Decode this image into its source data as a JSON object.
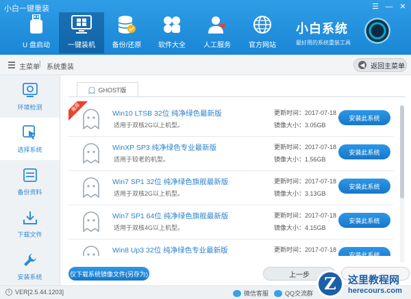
{
  "window": {
    "title": "小白一键重装"
  },
  "toolbar": [
    {
      "label": "U 盘启动",
      "icon": "usb-drive-icon"
    },
    {
      "label": "一键装机",
      "icon": "monitor-windows-icon",
      "active": true
    },
    {
      "label": "备份/还原",
      "icon": "database-backup-icon"
    },
    {
      "label": "软件大全",
      "icon": "apps-clover-icon"
    },
    {
      "label": "人工服务",
      "icon": "person-heart-icon"
    },
    {
      "label": "官方网站",
      "icon": "globe-icon"
    }
  ],
  "brand": {
    "name": "小白系统",
    "slogan": "最好用的系统重装工具"
  },
  "breadcrumb": {
    "home": "主菜单",
    "separator": "|",
    "current": "系统重装"
  },
  "back_button": "返回主菜单",
  "sidebar": [
    {
      "label": "环境检测",
      "icon": "checkup-icon"
    },
    {
      "label": "选择系统",
      "icon": "cursor-select-icon",
      "active": true
    },
    {
      "label": "备份资料",
      "icon": "backup-list-icon"
    },
    {
      "label": "下载文件",
      "icon": "download-icon"
    },
    {
      "label": "安装系统",
      "icon": "wrench-icon"
    }
  ],
  "tab": {
    "label": "GHOST版"
  },
  "systems": [
    {
      "title": "Win10 LTSB 32位 纯净绿色最新版",
      "desc": "适用于双核2G以上机型。",
      "updated": "更新时间：2017-07-18",
      "size": "镜像大小：3.05GB",
      "button": "安装此系统",
      "badge": "推荐"
    },
    {
      "title": "WinXP SP3 纯净绿色专业最新版",
      "desc": "适用于较老的机型。",
      "updated": "更新时间：2017-07-18",
      "size": "镜像大小：1.56GB",
      "button": "安装此系统"
    },
    {
      "title": "Win7 SP1 32位 纯净绿色旗舰最新版",
      "desc": "适用于双核2G以上机型。",
      "updated": "更新时间：2017-07-18",
      "size": "镜像大小：3.13GB",
      "button": "安装此系统"
    },
    {
      "title": "Win7 SP1 64位 纯净绿色旗舰最新版",
      "desc": "适用于双核4G以上机型。",
      "updated": "更新时间：2017-07-18",
      "size": "镜像大小：4.15GB",
      "button": "安装此系统"
    },
    {
      "title": "Win8 Up3 32位 纯净绿色专业最新版",
      "desc": "",
      "updated": "更新时间：2017-07-18",
      "size": "",
      "button": "安装此系统"
    }
  ],
  "bottom": {
    "download_only": "仅下载系统镜像文件(另存为)",
    "prev": "上一步"
  },
  "status": {
    "version": "VER[2.5.44.1203]",
    "wechat": "微信客服",
    "qq": "QQ交流群"
  },
  "watermark": {
    "logo_letter": "Z",
    "cn": "这里教程网",
    "en": "herecours.com"
  },
  "colors": {
    "toolbar_blue": "#1a86d6",
    "link_blue": "#2a83cc",
    "badge_red": "#e8432e"
  }
}
